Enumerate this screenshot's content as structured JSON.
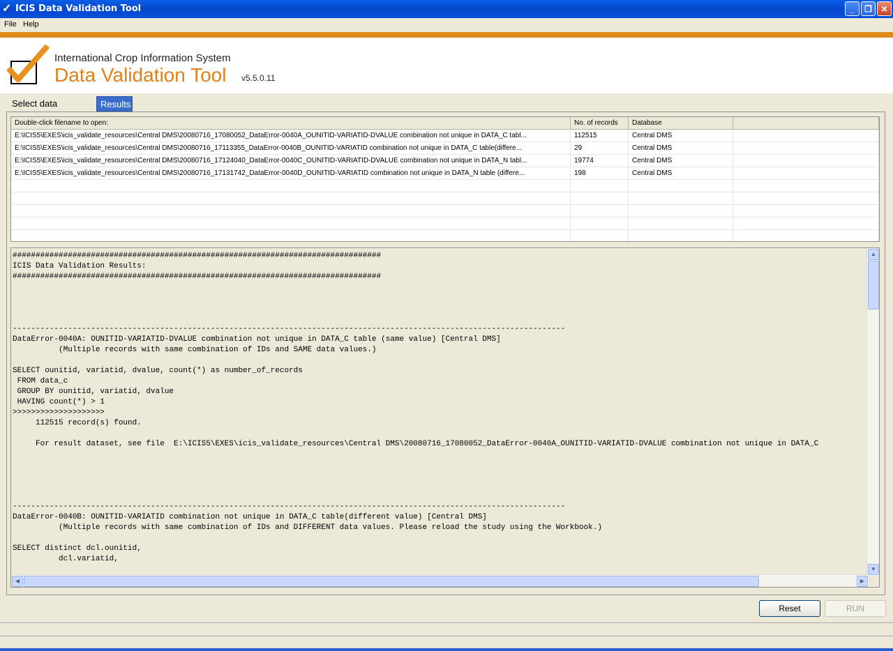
{
  "window": {
    "title": "ICIS Data Validation Tool",
    "app_icon": "checkmark-icon"
  },
  "menu": {
    "items": [
      "File",
      "Help"
    ]
  },
  "header": {
    "subtitle": "International Crop Information System",
    "title": "Data Validation Tool",
    "version": "v5.5.0.11",
    "accent_color": "#e0821a"
  },
  "tabs": [
    {
      "label": "Select data check(s)",
      "active": false
    },
    {
      "label": "Results",
      "active": true
    }
  ],
  "table": {
    "columns": [
      "Double-click filename to open:",
      "No. of records",
      "Database",
      ""
    ],
    "rows": [
      [
        "E:\\ICIS5\\EXES\\icis_validate_resources\\Central DMS\\20080716_17080052_DataError-0040A_OUNITID-VARIATID-DVALUE combination not unique in DATA_C tabl...",
        "112515",
        "Central DMS"
      ],
      [
        "E:\\ICIS5\\EXES\\icis_validate_resources\\Central DMS\\20080716_17113355_DataError-0040B_OUNITID-VARIATID combination not unique in DATA_C table(differe...",
        "29",
        "Central DMS"
      ],
      [
        "E:\\ICIS5\\EXES\\icis_validate_resources\\Central DMS\\20080716_17124040_DataError-0040C_OUNITID-VARIATID-DVALUE combination not unique in DATA_N tabl...",
        "19774",
        "Central DMS"
      ],
      [
        "E:\\ICIS5\\EXES\\icis_validate_resources\\Central DMS\\20080716_17131742_DataError-0040D_OUNITID-VARIATID combination not unique in DATA_N table (differe...",
        "198",
        "Central DMS"
      ]
    ]
  },
  "output": {
    "text": "################################################################################\nICIS Data Validation Results:\n################################################################################\n\n\n\n\n------------------------------------------------------------------------------------------------------------------------\nDataError-0040A: OUNITID-VARIATID-DVALUE combination not unique in DATA_C table (same value) [Central DMS]\n          (Multiple records with same combination of IDs and SAME data values.)\n\nSELECT ounitid, variatid, dvalue, count(*) as number_of_records\n FROM data_c\n GROUP BY ounitid, variatid, dvalue\n HAVING count(*) > 1\n>>>>>>>>>>>>>>>>>>>>\n     112515 record(s) found.\n\n     For result dataset, see file  E:\\ICIS5\\EXES\\icis_validate_resources\\Central DMS\\20080716_17080052_DataError-0040A_OUNITID-VARIATID-DVALUE combination not unique in DATA_C\n\n\n\n\n\n------------------------------------------------------------------------------------------------------------------------\nDataError-0040B: OUNITID-VARIATID combination not unique in DATA_C table(different value) [Central DMS]\n          (Multiple records with same combination of IDs and DIFFERENT data values. Please reload the study using the Workbook.)\n\nSELECT distinct dcl.ounitid,\n          dcl.variatid,"
  },
  "buttons": {
    "reset": "Reset",
    "run": "RUN"
  }
}
